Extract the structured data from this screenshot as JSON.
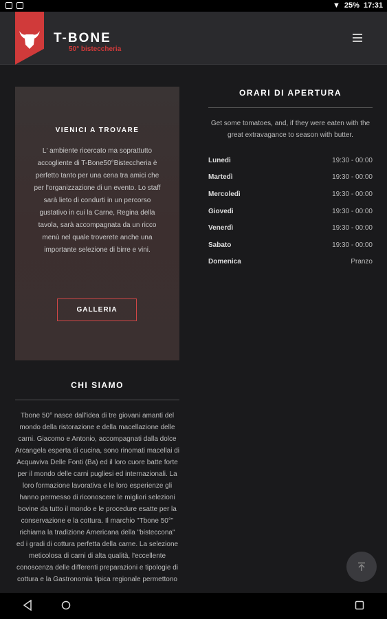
{
  "status": {
    "battery": "25%",
    "time": "17:31"
  },
  "brand": {
    "name": "T-BONE",
    "sub": "50° bisteccheria"
  },
  "visit": {
    "title": "VIENICI A TROVARE",
    "text": "L' ambiente ricercato ma soprattutto accogliente di T-Bone50°Bisteccheria è perfetto tanto per una cena tra amici che per l'organizzazione di un evento. Lo staff sarà lieto di condurti in un percorso gustativo in cui la Carne, Regina della tavola, sarà accompagnata da un ricco menù nel quale troverete anche una importante selezione di birre e vini.",
    "button": "GALLERIA"
  },
  "about": {
    "title": "CHI SIAMO",
    "text": "Tbone 50° nasce dall'idea di tre giovani amanti del mondo della ristorazione e della macellazione delle carni. Giacomo e Antonio, accompagnati dalla dolce Arcangela esperta di cucina, sono rinomati macellai di Acquaviva Delle Fonti (Ba) ed il loro cuore batte forte per il mondo delle carni pugliesi ed internazionali. La loro formazione lavorativa e le loro esperienze gli hanno permesso di riconoscere le migliori selezioni bovine da tutto il mondo e le procedure esatte per la conservazione e la cottura. Il marchio \"Tbone 50°\" richiama la tradizione Americana della \"bisteccona\" ed i gradi di cottura perfetta della carne. La selezione meticolosa di carni di alta qualità, l'eccellente conoscenza delle differenti preparazioni e tipologie di cottura e la Gastronomia tipica regionale permettono"
  },
  "hours": {
    "title": "ORARI DI APERTURA",
    "description": "Get some tomatoes, and, if they were eaten with the great extravagance to season with butter.",
    "rows": [
      {
        "day": "Lunedì",
        "time": "19:30 - 00:00"
      },
      {
        "day": "Martedì",
        "time": "19:30 - 00:00"
      },
      {
        "day": "Mercoledì",
        "time": "19:30 - 00:00"
      },
      {
        "day": "Giovedì",
        "time": "19:30 - 00:00"
      },
      {
        "day": "Venerdì",
        "time": "19:30 - 00:00"
      },
      {
        "day": "Sabato",
        "time": "19:30 - 00:00"
      },
      {
        "day": "Domenica",
        "time": "Pranzo"
      }
    ]
  },
  "icons": {
    "menu": "hamburger-icon",
    "back_to_top": "arrow-up-icon",
    "nav_back": "triangle-back-icon",
    "nav_home": "circle-home-icon",
    "nav_recents": "square-recents-icon"
  },
  "colors": {
    "accent": "#d03a3a",
    "background": "#1a1a1c",
    "header": "#2a2a2d"
  }
}
